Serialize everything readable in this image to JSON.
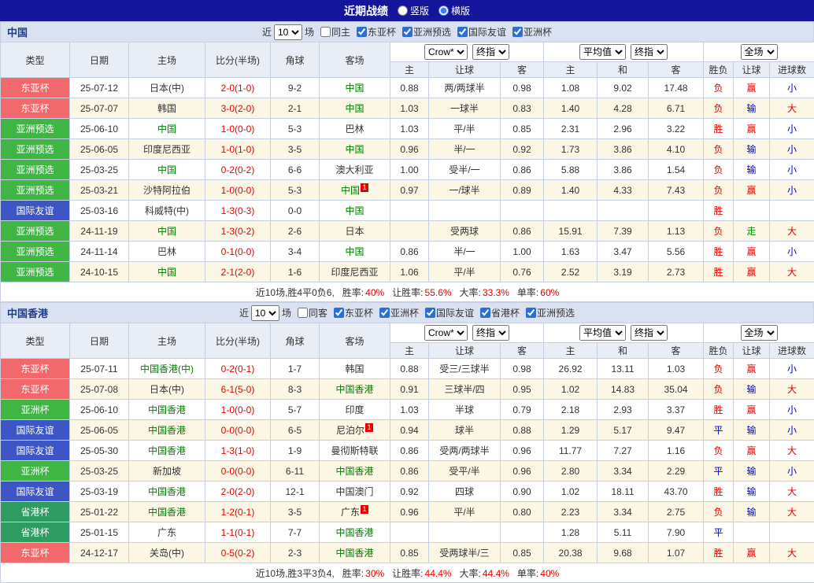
{
  "title_bar": {
    "title": "近期战绩",
    "options": [
      {
        "label": "竖版",
        "selected": false
      },
      {
        "label": "横版",
        "selected": true
      }
    ]
  },
  "type_colors": {
    "东亚杯": "#F2696B",
    "亚洲预选": "#3FB544",
    "国际友谊": "#3E55C6",
    "亚洲杯": "#3FB544",
    "省港杯": "#2E9B62"
  },
  "value_colors": {
    "胜": "#E60000",
    "平": "#0000CC",
    "负": "#E60000",
    "赢": "#E60000",
    "输": "#0000CC",
    "走": "#009900",
    "大": "#E60000",
    "小": "#0000CC"
  },
  "sections": [
    {
      "name": "中国",
      "filter": {
        "prefix": "近",
        "count": "10",
        "suffix": "场",
        "same": {
          "label": "同主",
          "checked": false
        },
        "comps": [
          {
            "label": "东亚杯",
            "checked": true
          },
          {
            "label": "亚洲预选",
            "checked": true
          },
          {
            "label": "国际友谊",
            "checked": true
          },
          {
            "label": "亚洲杯",
            "checked": true
          }
        ]
      },
      "columns": [
        "类型",
        "日期",
        "主场",
        "比分(半场)",
        "角球",
        "客场"
      ],
      "odds_groups": [
        {
          "selects": [
            "Crow*",
            "终指"
          ],
          "cols": [
            "主",
            "让球",
            "客"
          ]
        },
        {
          "selects": [
            "平均值",
            "终指"
          ],
          "cols": [
            "主",
            "和",
            "客"
          ]
        }
      ],
      "result_group": {
        "selects": [
          "全场"
        ],
        "cols": [
          "胜负",
          "让球",
          "进球数"
        ]
      },
      "rows": [
        {
          "type": "东亚杯",
          "date": "25-07-12",
          "home": "日本(中)",
          "hg": false,
          "hr": 0,
          "score": "2-0(1-0)",
          "corner": "9-2",
          "away": "中国",
          "ag": true,
          "ar": 0,
          "h": "0.88",
          "hcap": "两/两球半",
          "a": "0.98",
          "m1": "1.08",
          "m2": "9.02",
          "m3": "17.48",
          "wl": "负",
          "lt": "赢",
          "ou": "小"
        },
        {
          "type": "东亚杯",
          "date": "25-07-07",
          "home": "韩国",
          "hg": false,
          "hr": 0,
          "score": "3-0(2-0)",
          "corner": "2-1",
          "away": "中国",
          "ag": true,
          "ar": 0,
          "h": "1.03",
          "hcap": "一球半",
          "a": "0.83",
          "m1": "1.40",
          "m2": "4.28",
          "m3": "6.71",
          "wl": "负",
          "lt": "输",
          "ou": "大"
        },
        {
          "type": "亚洲预选",
          "date": "25-06-10",
          "home": "中国",
          "hg": true,
          "hr": 0,
          "score": "1-0(0-0)",
          "corner": "5-3",
          "away": "巴林",
          "ag": false,
          "ar": 0,
          "h": "1.03",
          "hcap": "平/半",
          "a": "0.85",
          "m1": "2.31",
          "m2": "2.96",
          "m3": "3.22",
          "wl": "胜",
          "lt": "赢",
          "ou": "小"
        },
        {
          "type": "亚洲预选",
          "date": "25-06-05",
          "home": "印度尼西亚",
          "hg": false,
          "hr": 0,
          "score": "1-0(1-0)",
          "corner": "3-5",
          "away": "中国",
          "ag": true,
          "ar": 0,
          "h": "0.96",
          "hcap": "半/一",
          "a": "0.92",
          "m1": "1.73",
          "m2": "3.86",
          "m3": "4.10",
          "wl": "负",
          "lt": "输",
          "ou": "小"
        },
        {
          "type": "亚洲预选",
          "date": "25-03-25",
          "home": "中国",
          "hg": true,
          "hr": 0,
          "score": "0-2(0-2)",
          "corner": "6-6",
          "away": "澳大利亚",
          "ag": false,
          "ar": 0,
          "h": "1.00",
          "hcap": "受半/一",
          "a": "0.86",
          "m1": "5.88",
          "m2": "3.86",
          "m3": "1.54",
          "wl": "负",
          "lt": "输",
          "ou": "小"
        },
        {
          "type": "亚洲预选",
          "date": "25-03-21",
          "home": "沙特阿拉伯",
          "hg": false,
          "hr": 0,
          "score": "1-0(0-0)",
          "corner": "5-3",
          "away": "中国",
          "ag": true,
          "ar": 1,
          "h": "0.97",
          "hcap": "一/球半",
          "a": "0.89",
          "m1": "1.40",
          "m2": "4.33",
          "m3": "7.43",
          "wl": "负",
          "lt": "赢",
          "ou": "小"
        },
        {
          "type": "国际友谊",
          "date": "25-03-16",
          "home": "科威特(中)",
          "hg": false,
          "hr": 0,
          "score": "1-3(0-3)",
          "corner": "0-0",
          "away": "中国",
          "ag": true,
          "ar": 0,
          "h": "",
          "hcap": "",
          "a": "",
          "m1": "",
          "m2": "",
          "m3": "",
          "wl": "胜",
          "lt": "",
          "ou": ""
        },
        {
          "type": "亚洲预选",
          "date": "24-11-19",
          "home": "中国",
          "hg": true,
          "hr": 0,
          "score": "1-3(0-2)",
          "corner": "2-6",
          "away": "日本",
          "ag": false,
          "ar": 0,
          "h": "",
          "hcap": "受两球",
          "a": "0.86",
          "m1": "15.91",
          "m2": "7.39",
          "m3": "1.13",
          "wl": "负",
          "lt": "走",
          "ou": "大"
        },
        {
          "type": "亚洲预选",
          "date": "24-11-14",
          "home": "巴林",
          "hg": false,
          "hr": 0,
          "score": "0-1(0-0)",
          "corner": "3-4",
          "away": "中国",
          "ag": true,
          "ar": 0,
          "h": "0.86",
          "hcap": "半/一",
          "a": "1.00",
          "m1": "1.63",
          "m2": "3.47",
          "m3": "5.56",
          "wl": "胜",
          "lt": "赢",
          "ou": "小"
        },
        {
          "type": "亚洲预选",
          "date": "24-10-15",
          "home": "中国",
          "hg": true,
          "hr": 0,
          "score": "2-1(2-0)",
          "corner": "1-6",
          "away": "印度尼西亚",
          "ag": false,
          "ar": 0,
          "h": "1.06",
          "hcap": "平/半",
          "a": "0.76",
          "m1": "2.52",
          "m2": "3.19",
          "m3": "2.73",
          "wl": "胜",
          "lt": "赢",
          "ou": "大"
        }
      ],
      "summary": {
        "prefix": "近10场,胜4平0负6,",
        "stats": [
          [
            "胜率:",
            "40%"
          ],
          [
            "让胜率:",
            "55.6%"
          ],
          [
            "大率:",
            "33.3%"
          ],
          [
            "单率:",
            "60%"
          ]
        ]
      }
    },
    {
      "name": "中国香港",
      "filter": {
        "prefix": "近",
        "count": "10",
        "suffix": "场",
        "same": {
          "label": "同客",
          "checked": false
        },
        "comps": [
          {
            "label": "东亚杯",
            "checked": true
          },
          {
            "label": "亚洲杯",
            "checked": true
          },
          {
            "label": "国际友谊",
            "checked": true
          },
          {
            "label": "省港杯",
            "checked": true
          },
          {
            "label": "亚洲预选",
            "checked": true
          }
        ]
      },
      "columns": [
        "类型",
        "日期",
        "主场",
        "比分(半场)",
        "角球",
        "客场"
      ],
      "odds_groups": [
        {
          "selects": [
            "Crow*",
            "终指"
          ],
          "cols": [
            "主",
            "让球",
            "客"
          ]
        },
        {
          "selects": [
            "平均值",
            "终指"
          ],
          "cols": [
            "主",
            "和",
            "客"
          ]
        }
      ],
      "result_group": {
        "selects": [
          "全场"
        ],
        "cols": [
          "胜负",
          "让球",
          "进球数"
        ]
      },
      "rows": [
        {
          "type": "东亚杯",
          "date": "25-07-11",
          "home": "中国香港(中)",
          "hg": true,
          "hr": 0,
          "score": "0-2(0-1)",
          "corner": "1-7",
          "away": "韩国",
          "ag": false,
          "ar": 0,
          "h": "0.88",
          "hcap": "受三/三球半",
          "a": "0.98",
          "m1": "26.92",
          "m2": "13.11",
          "m3": "1.03",
          "wl": "负",
          "lt": "赢",
          "ou": "小"
        },
        {
          "type": "东亚杯",
          "date": "25-07-08",
          "home": "日本(中)",
          "hg": false,
          "hr": 0,
          "score": "6-1(5-0)",
          "corner": "8-3",
          "away": "中国香港",
          "ag": true,
          "ar": 0,
          "h": "0.91",
          "hcap": "三球半/四",
          "a": "0.95",
          "m1": "1.02",
          "m2": "14.83",
          "m3": "35.04",
          "wl": "负",
          "lt": "输",
          "ou": "大"
        },
        {
          "type": "亚洲杯",
          "date": "25-06-10",
          "home": "中国香港",
          "hg": true,
          "hr": 0,
          "score": "1-0(0-0)",
          "corner": "5-7",
          "away": "印度",
          "ag": false,
          "ar": 0,
          "h": "1.03",
          "hcap": "半球",
          "a": "0.79",
          "m1": "2.18",
          "m2": "2.93",
          "m3": "3.37",
          "wl": "胜",
          "lt": "赢",
          "ou": "小"
        },
        {
          "type": "国际友谊",
          "date": "25-06-05",
          "home": "中国香港",
          "hg": true,
          "hr": 0,
          "score": "0-0(0-0)",
          "corner": "6-5",
          "away": "尼泊尔",
          "ag": false,
          "ar": 1,
          "h": "0.94",
          "hcap": "球半",
          "a": "0.88",
          "m1": "1.29",
          "m2": "5.17",
          "m3": "9.47",
          "wl": "平",
          "lt": "输",
          "ou": "小"
        },
        {
          "type": "国际友谊",
          "date": "25-05-30",
          "home": "中国香港",
          "hg": true,
          "hr": 0,
          "score": "1-3(1-0)",
          "corner": "1-9",
          "away": "曼彻斯特联",
          "ag": false,
          "ar": 0,
          "h": "0.86",
          "hcap": "受两/两球半",
          "a": "0.96",
          "m1": "11.77",
          "m2": "7.27",
          "m3": "1.16",
          "wl": "负",
          "lt": "赢",
          "ou": "大"
        },
        {
          "type": "亚洲杯",
          "date": "25-03-25",
          "home": "新加坡",
          "hg": false,
          "hr": 0,
          "score": "0-0(0-0)",
          "corner": "6-11",
          "away": "中国香港",
          "ag": true,
          "ar": 0,
          "h": "0.86",
          "hcap": "受平/半",
          "a": "0.96",
          "m1": "2.80",
          "m2": "3.34",
          "m3": "2.29",
          "wl": "平",
          "lt": "输",
          "ou": "小"
        },
        {
          "type": "国际友谊",
          "date": "25-03-19",
          "home": "中国香港",
          "hg": true,
          "hr": 0,
          "score": "2-0(2-0)",
          "corner": "12-1",
          "away": "中国澳门",
          "ag": false,
          "ar": 0,
          "h": "0.92",
          "hcap": "四球",
          "a": "0.90",
          "m1": "1.02",
          "m2": "18.11",
          "m3": "43.70",
          "wl": "胜",
          "lt": "输",
          "ou": "大"
        },
        {
          "type": "省港杯",
          "date": "25-01-22",
          "home": "中国香港",
          "hg": true,
          "hr": 0,
          "score": "1-2(0-1)",
          "corner": "3-5",
          "away": "广东",
          "ag": false,
          "ar": 1,
          "h": "0.96",
          "hcap": "平/半",
          "a": "0.80",
          "m1": "2.23",
          "m2": "3.34",
          "m3": "2.75",
          "wl": "负",
          "lt": "输",
          "ou": "大"
        },
        {
          "type": "省港杯",
          "date": "25-01-15",
          "home": "广东",
          "hg": false,
          "hr": 0,
          "score": "1-1(0-1)",
          "corner": "7-7",
          "away": "中国香港",
          "ag": true,
          "ar": 0,
          "h": "",
          "hcap": "",
          "a": "",
          "m1": "1.28",
          "m2": "5.11",
          "m3": "7.90",
          "wl": "平",
          "lt": "",
          "ou": ""
        },
        {
          "type": "东亚杯",
          "date": "24-12-17",
          "home": "关岛(中)",
          "hg": false,
          "hr": 0,
          "score": "0-5(0-2)",
          "corner": "2-3",
          "away": "中国香港",
          "ag": true,
          "ar": 0,
          "h": "0.85",
          "hcap": "受两球半/三",
          "a": "0.85",
          "m1": "20.38",
          "m2": "9.68",
          "m3": "1.07",
          "wl": "胜",
          "lt": "赢",
          "ou": "大"
        }
      ],
      "summary": {
        "prefix": "近10场,胜3平3负4,",
        "stats": [
          [
            "胜率:",
            "30%"
          ],
          [
            "让胜率:",
            "44.4%"
          ],
          [
            "大率:",
            "44.4%"
          ],
          [
            "单率:",
            "40%"
          ]
        ]
      }
    }
  ]
}
